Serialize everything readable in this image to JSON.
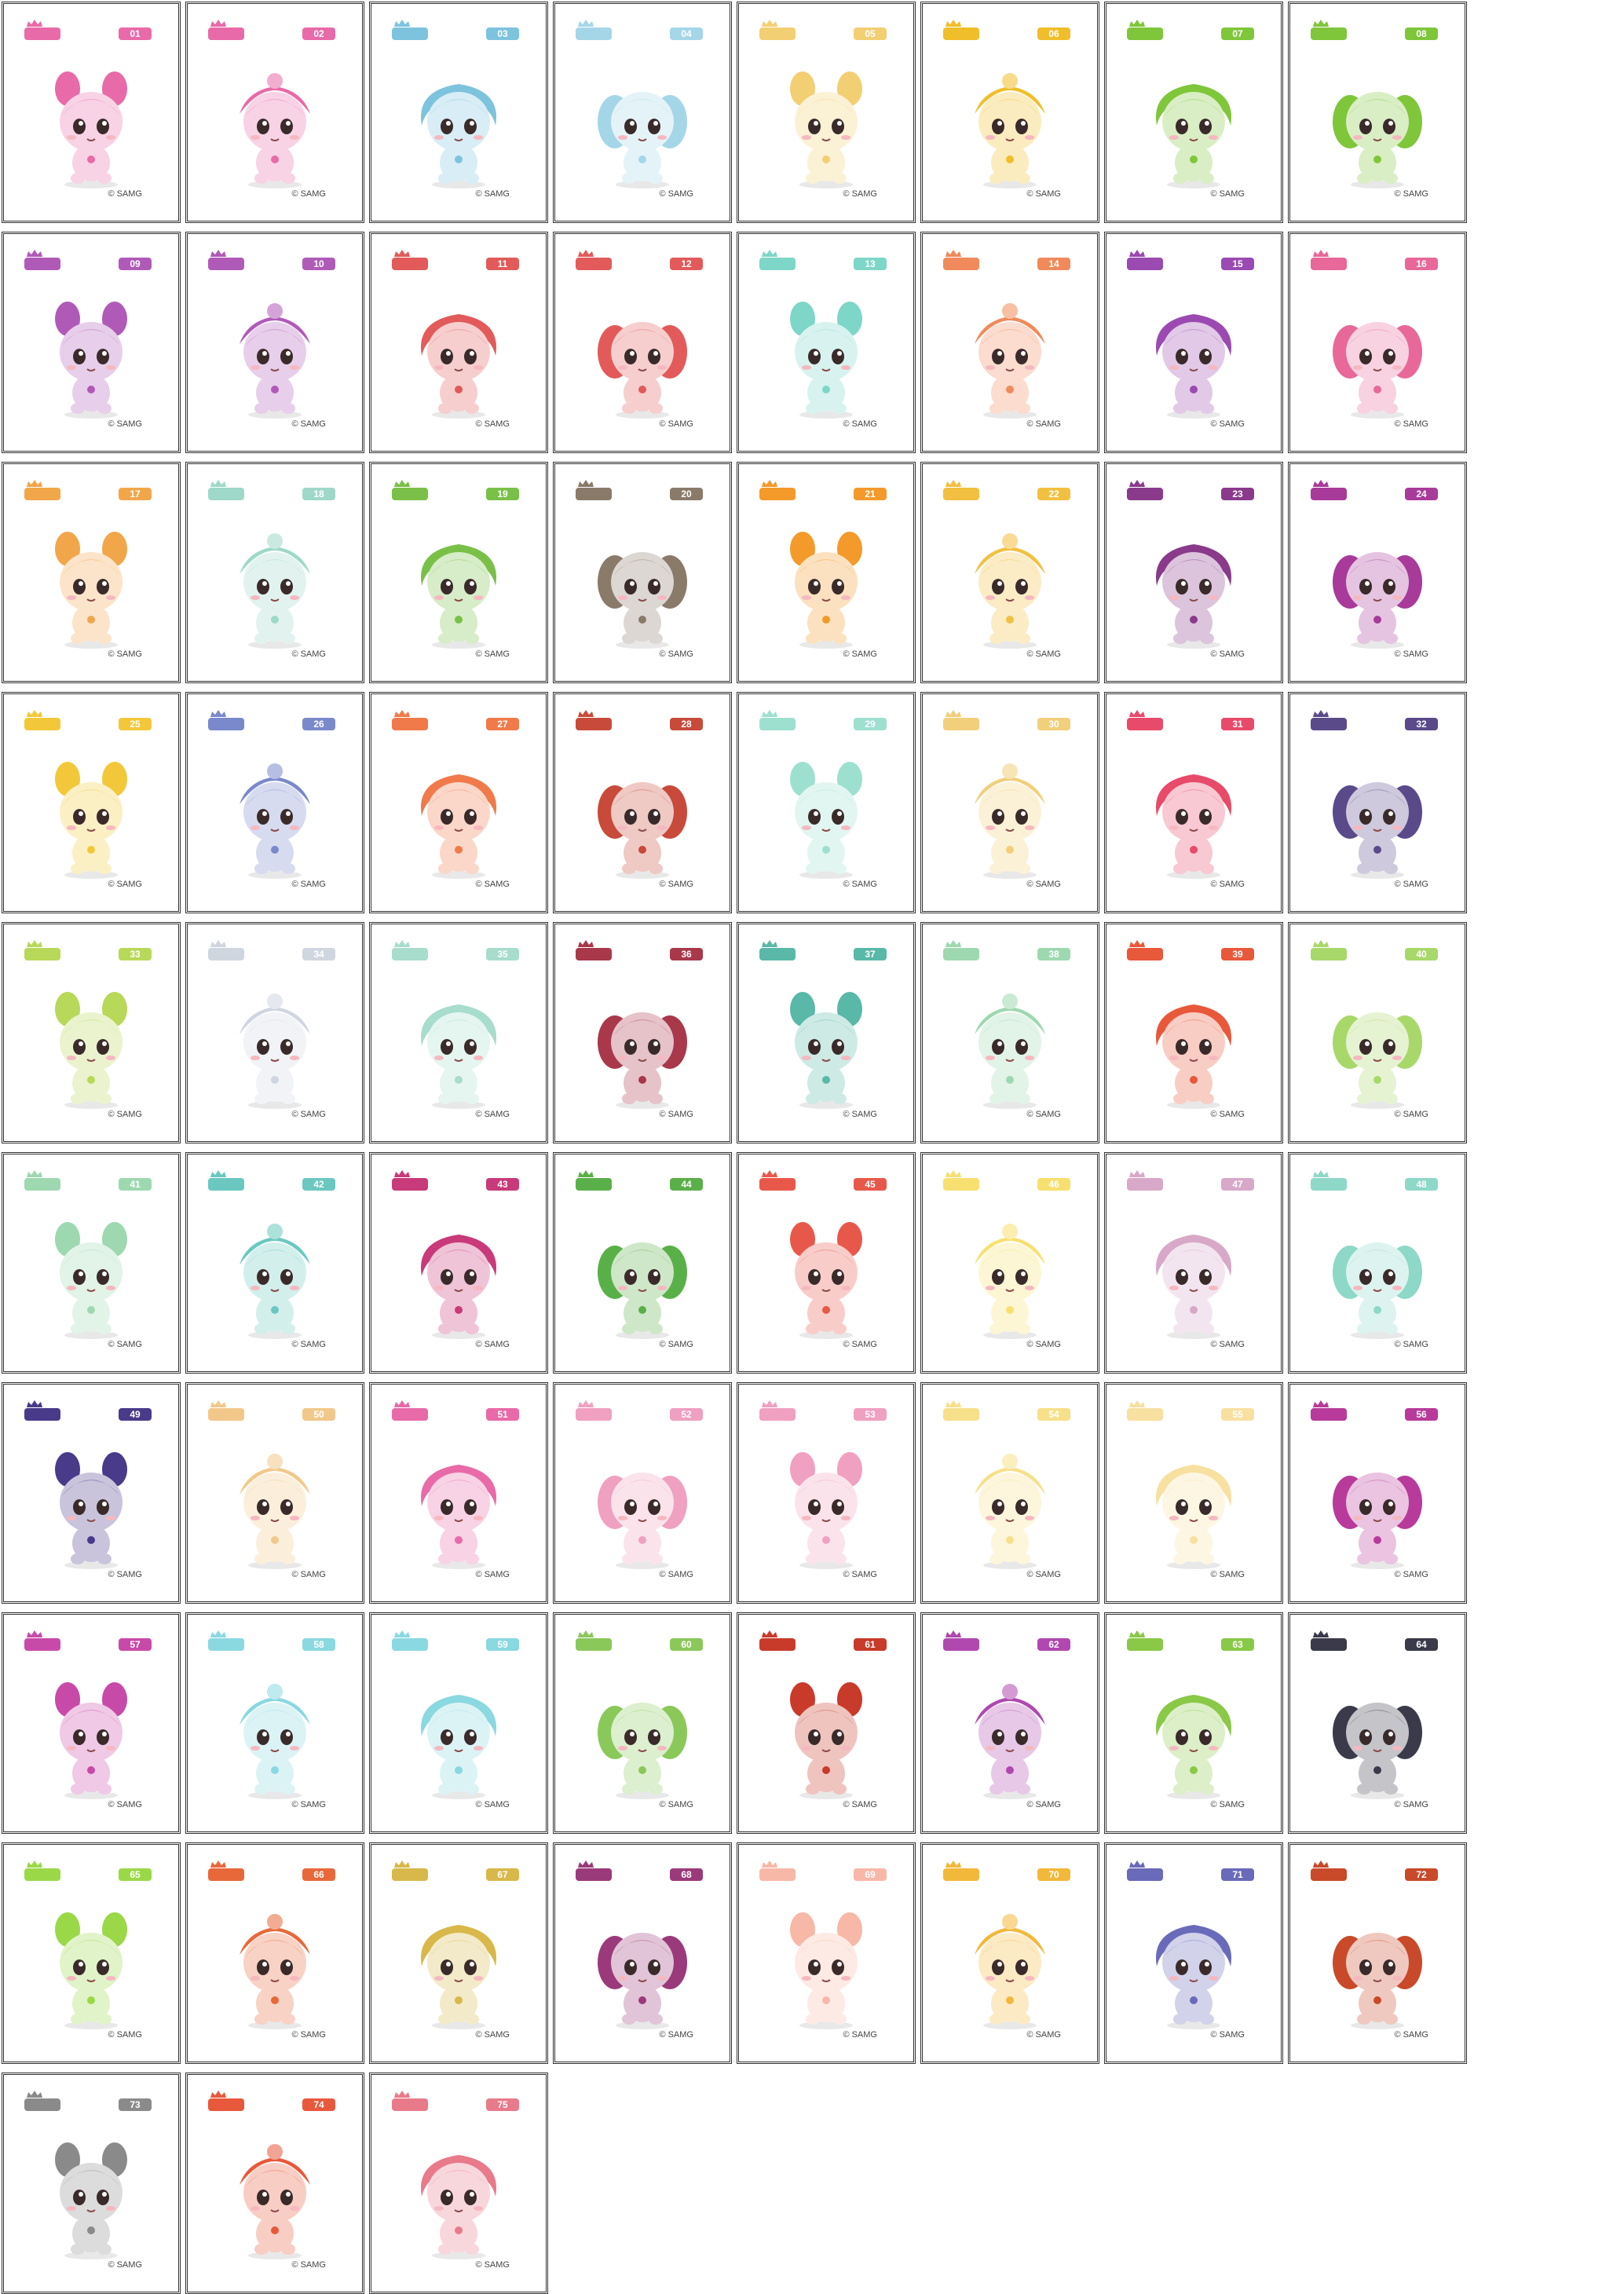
{
  "copyright_text": "© SAMG",
  "cards": [
    {
      "number": "01",
      "name": "",
      "color": "#e86aa8"
    },
    {
      "number": "02",
      "name": "",
      "color": "#e86aa8"
    },
    {
      "number": "03",
      "name": "",
      "color": "#7ec3dd"
    },
    {
      "number": "04",
      "name": "",
      "color": "#a5d6e8"
    },
    {
      "number": "05",
      "name": "",
      "color": "#f3cf73"
    },
    {
      "number": "06",
      "name": "",
      "color": "#f0be2a"
    },
    {
      "number": "07",
      "name": "",
      "color": "#7fc63a"
    },
    {
      "number": "08",
      "name": "",
      "color": "#7fc63a"
    },
    {
      "number": "09",
      "name": "",
      "color": "#b05ab8"
    },
    {
      "number": "10",
      "name": "",
      "color": "#b05ab8"
    },
    {
      "number": "11",
      "name": "",
      "color": "#e25a5a"
    },
    {
      "number": "12",
      "name": "",
      "color": "#e25a5a"
    },
    {
      "number": "13",
      "name": "",
      "color": "#7ed6c8"
    },
    {
      "number": "14",
      "name": "",
      "color": "#f08a5a"
    },
    {
      "number": "15",
      "name": "",
      "color": "#9a4ab0"
    },
    {
      "number": "16",
      "name": "",
      "color": "#e8689a"
    },
    {
      "number": "17",
      "name": "",
      "color": "#f2a64a"
    },
    {
      "number": "18",
      "name": "",
      "color": "#9ed8c8"
    },
    {
      "number": "19",
      "name": "",
      "color": "#7ac048"
    },
    {
      "number": "20",
      "name": "",
      "color": "#8a7a6a"
    },
    {
      "number": "21",
      "name": "",
      "color": "#f39a2a"
    },
    {
      "number": "22",
      "name": "",
      "color": "#f2c040"
    },
    {
      "number": "23",
      "name": "",
      "color": "#8a3a8a"
    },
    {
      "number": "24",
      "name": "",
      "color": "#a83a9a"
    },
    {
      "number": "25",
      "name": "",
      "color": "#f2c83a"
    },
    {
      "number": "26",
      "name": "",
      "color": "#7a88cc"
    },
    {
      "number": "27",
      "name": "",
      "color": "#f07a4a"
    },
    {
      "number": "28",
      "name": "",
      "color": "#c84a3a"
    },
    {
      "number": "29",
      "name": "",
      "color": "#9ee0d0"
    },
    {
      "number": "30",
      "name": "",
      "color": "#f2cf7a"
    },
    {
      "number": "31",
      "name": "",
      "color": "#e84a6a"
    },
    {
      "number": "32",
      "name": "",
      "color": "#5a4a8a"
    },
    {
      "number": "33",
      "name": "",
      "color": "#b8d85a"
    },
    {
      "number": "34",
      "name": "",
      "color": "#cfd6e0"
    },
    {
      "number": "35",
      "name": "",
      "color": "#a8dccd"
    },
    {
      "number": "36",
      "name": "",
      "color": "#a8384a"
    },
    {
      "number": "37",
      "name": "",
      "color": "#5ab8a8"
    },
    {
      "number": "38",
      "name": "",
      "color": "#9ed8b0"
    },
    {
      "number": "39",
      "name": "",
      "color": "#e8583a"
    },
    {
      "number": "40",
      "name": "",
      "color": "#a8d86a"
    },
    {
      "number": "41",
      "name": "",
      "color": "#9ed8b0"
    },
    {
      "number": "42",
      "name": "",
      "color": "#6ac8c0"
    },
    {
      "number": "43",
      "name": "",
      "color": "#c83a7a"
    },
    {
      "number": "44",
      "name": "",
      "color": "#5ab048"
    },
    {
      "number": "45",
      "name": "",
      "color": "#e8584a"
    },
    {
      "number": "46",
      "name": "",
      "color": "#f7e070"
    },
    {
      "number": "47",
      "name": "",
      "color": "#d8a8c8"
    },
    {
      "number": "48",
      "name": "",
      "color": "#8ed8c8"
    },
    {
      "number": "49",
      "name": "",
      "color": "#4a3a8a"
    },
    {
      "number": "50",
      "name": "",
      "color": "#f2c88a"
    },
    {
      "number": "51",
      "name": "",
      "color": "#e86aa8"
    },
    {
      "number": "52",
      "name": "",
      "color": "#f0a0c0"
    },
    {
      "number": "53",
      "name": "",
      "color": "#f0a0c0"
    },
    {
      "number": "54",
      "name": "",
      "color": "#f7e08a"
    },
    {
      "number": "55",
      "name": "",
      "color": "#f7e0a0"
    },
    {
      "number": "56",
      "name": "",
      "color": "#b83a9a"
    },
    {
      "number": "57",
      "name": "",
      "color": "#c84aa8"
    },
    {
      "number": "58",
      "name": "",
      "color": "#8ad8e0"
    },
    {
      "number": "59",
      "name": "",
      "color": "#8ad8e0"
    },
    {
      "number": "60",
      "name": "",
      "color": "#8ac85a"
    },
    {
      "number": "61",
      "name": "",
      "color": "#c83a2a"
    },
    {
      "number": "62",
      "name": "",
      "color": "#b048b0"
    },
    {
      "number": "63",
      "name": "",
      "color": "#8ac848"
    },
    {
      "number": "64",
      "name": "",
      "color": "#3a3a4a"
    },
    {
      "number": "65",
      "name": "",
      "color": "#9ad848"
    },
    {
      "number": "66",
      "name": "",
      "color": "#e8683a"
    },
    {
      "number": "67",
      "name": "",
      "color": "#d8b84a"
    },
    {
      "number": "68",
      "name": "",
      "color": "#9a3a7a"
    },
    {
      "number": "69",
      "name": "",
      "color": "#f7b8a8"
    },
    {
      "number": "70",
      "name": "",
      "color": "#f2b83a"
    },
    {
      "number": "71",
      "name": "",
      "color": "#6a6aba"
    },
    {
      "number": "72",
      "name": "",
      "color": "#c84a2a"
    },
    {
      "number": "73",
      "name": "",
      "color": "#8a8a8a"
    },
    {
      "number": "74",
      "name": "",
      "color": "#e8583a"
    },
    {
      "number": "75",
      "name": "",
      "color": "#e87a8a"
    }
  ]
}
